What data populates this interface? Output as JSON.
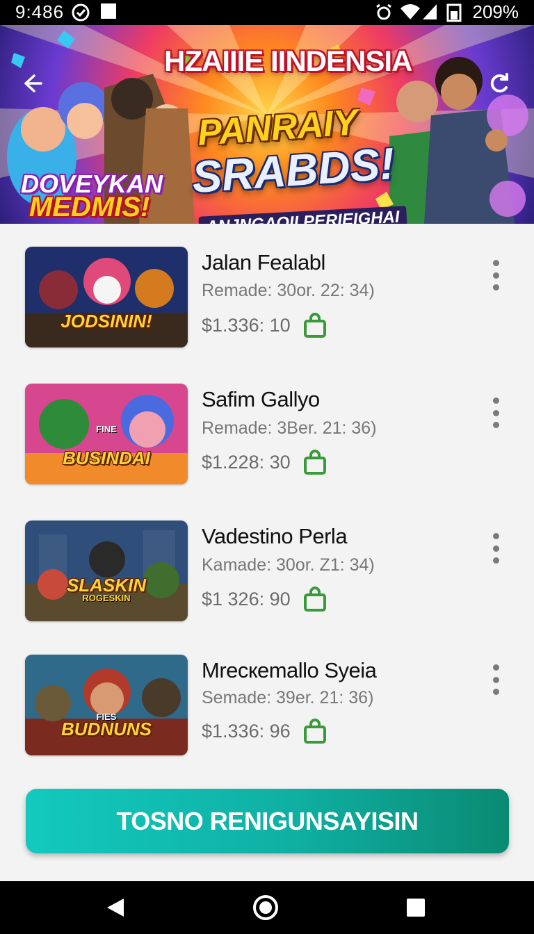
{
  "status_bar": {
    "time": "9:486",
    "battery": "209%"
  },
  "banner": {
    "title": "HZAIIIE IINDENSIA",
    "headline_top": "PANRAIY",
    "headline_main": "SRABDS!",
    "subtitle": "ANJNGAOII PERIEIGHAI",
    "left_badge_1": "DOVEYKAN",
    "left_badge_2": "MEDMIS!"
  },
  "items": [
    {
      "title": "Jalan Fealabl",
      "subtitle": "Remade: 30or. 22: 34)",
      "price": "$1.336: 10",
      "thumb_label": "JODSININ!",
      "thumb_small": "",
      "thumb_colors": [
        "#1e2f6b",
        "#8a2b38",
        "#d47a1f"
      ]
    },
    {
      "title": "Safim Gallyo",
      "subtitle": "Remade: 3Ber. 21: 36)",
      "price": "$1.228: 30",
      "thumb_label": "BUSINDAI",
      "thumb_small": "FINE",
      "thumb_colors": [
        "#2e8b3a",
        "#d7478f",
        "#f08a2a"
      ]
    },
    {
      "title": "Vadestino Perla",
      "subtitle": "Kamade: 30or. Z1: 34)",
      "price": "$1 326: 90",
      "thumb_label": "SLASKIN",
      "thumb_small": "ROGESKIN",
      "thumb_colors": [
        "#2f4f7a",
        "#3f6e2f",
        "#c99b3a"
      ]
    },
    {
      "title": "Mrecкemallo Syeia",
      "subtitle": "Semade: 39er. 21: 36)",
      "price": "$1.336: 96",
      "thumb_label": "BUDNUNS",
      "thumb_small": "FIES",
      "thumb_colors": [
        "#7a2a1e",
        "#b23a2a",
        "#2f6a8a"
      ]
    }
  ],
  "cta": {
    "label": "TOSNO RENIGUNSAYISIN"
  },
  "colors": {
    "accent": "#13c9be",
    "bag": "#3a9a3a"
  }
}
